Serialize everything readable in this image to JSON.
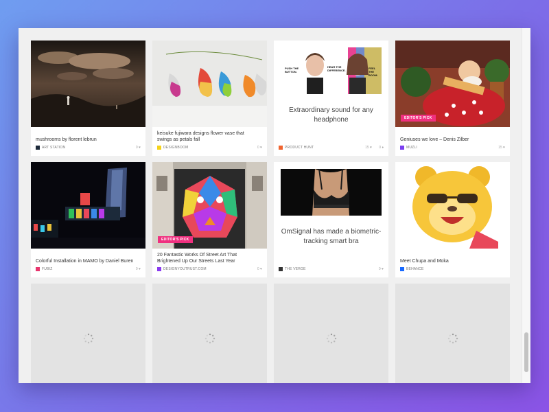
{
  "cards": [
    {
      "title": "mushrooms by florent lebrun",
      "source": "ART STATION",
      "likes": "0",
      "icon_color": "#1d2a3a",
      "badge": ""
    },
    {
      "title": "keisuke fujiwara designs flower vase that swings as petals fall",
      "source": "DESIGNBOOM",
      "likes": "0",
      "icon_color": "#f5d31a",
      "badge": ""
    },
    {
      "title": "Extraordinary sound for any headphone",
      "source": "PRODUCT HUNT",
      "views": "15",
      "likes": "0",
      "icon_color": "#f0642f",
      "badge": "",
      "ad_texts": [
        "PUSH THE BUTTON.",
        "HEAR THE DIFFERENCE.",
        "FEEL THE BOOM."
      ]
    },
    {
      "title": "Geniuses we love – Denis Zilber",
      "source": "MUZLI",
      "likes": "15",
      "icon_color": "#7b3ff0",
      "badge": "EDITOR'S PICK"
    },
    {
      "title": "Colorful Installation in MAMO by Daniel Buren",
      "source": "FUBIZ",
      "likes": "0",
      "icon_color": "#e8356d",
      "badge": ""
    },
    {
      "title": "20 Fantastic Works Of Street Art That Brightened Up Our Streets Last Year",
      "source": "DESIGNYOUTRUST.COM",
      "likes": "0",
      "icon_color": "#8b3cf0",
      "badge": "EDITOR'S PICK"
    },
    {
      "title": "OmSignal has made a biometric-tracking smart bra",
      "source": "THE VERGE",
      "likes": "0",
      "icon_color": "#333333",
      "badge": ""
    },
    {
      "title": "Meet Chupa and Moka",
      "source": "BEHANCE",
      "likes": "0",
      "icon_color": "#1769ff",
      "badge": ""
    }
  ],
  "icons": {
    "like": "heart-icon",
    "spinner": "spinner-icon"
  },
  "colors": {
    "badge": "#f0307f",
    "window_bg": "#f0f0f0"
  }
}
